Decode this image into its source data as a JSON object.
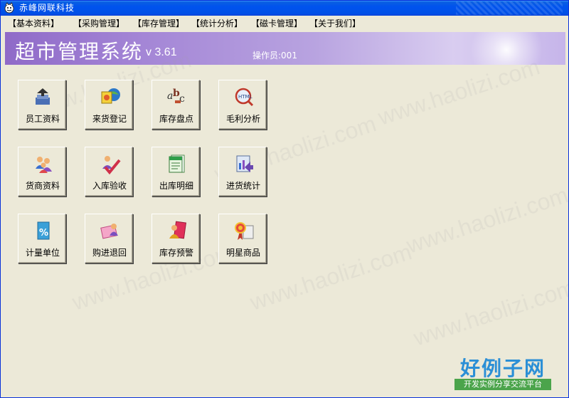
{
  "window": {
    "title": "赤峰网联科技"
  },
  "menu": [
    "【基本资料】",
    "【采购管理】",
    "【库存管理】",
    "【统计分析】",
    "【磁卡管理】",
    "【关于我们】"
  ],
  "banner": {
    "system_title": "超市管理系统",
    "version": "v 3.61",
    "operator": "操作员:001"
  },
  "tiles": [
    {
      "label": "员工资料",
      "icon": "employee-icon"
    },
    {
      "label": "来货登记",
      "icon": "goods-register-icon"
    },
    {
      "label": "库存盘点",
      "icon": "stock-count-icon"
    },
    {
      "label": "毛利分析",
      "icon": "profit-analysis-icon"
    },
    {
      "label": "货商资料",
      "icon": "supplier-icon"
    },
    {
      "label": "入库验收",
      "icon": "checkin-icon"
    },
    {
      "label": "出库明细",
      "icon": "outbound-detail-icon"
    },
    {
      "label": "进货统计",
      "icon": "purchase-stats-icon"
    },
    {
      "label": "计量单位",
      "icon": "unit-icon"
    },
    {
      "label": "购进退回",
      "icon": "purchase-return-icon"
    },
    {
      "label": "库存预警",
      "icon": "stock-alert-icon"
    },
    {
      "label": "明星商品",
      "icon": "star-product-icon"
    }
  ],
  "watermark": {
    "text": "www.haolizi.com"
  },
  "logo": {
    "main": "好例子网",
    "sub": "开发实例分享交流平台"
  }
}
